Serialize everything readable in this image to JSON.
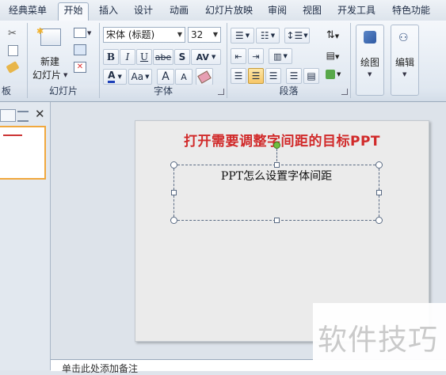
{
  "tabs": [
    "经典菜单",
    "开始",
    "插入",
    "设计",
    "动画",
    "幻灯片放映",
    "审阅",
    "视图",
    "开发工具",
    "特色功能"
  ],
  "active_tab": "开始",
  "ribbon": {
    "slides_group": {
      "label": "幻灯片",
      "new_slide_line1": "新建",
      "new_slide_line2": "幻灯片"
    },
    "font_group": {
      "label": "字体",
      "font_name": "宋体 (标题)",
      "font_size": "32",
      "bold": "B",
      "italic": "I",
      "underline": "U",
      "strikethrough": "abe",
      "shadow": "S",
      "char_spacing": "AV",
      "font_color": "A",
      "change_case": "Aa",
      "grow_font": "A",
      "shrink_font": "A"
    },
    "paragraph_group": {
      "label": "段落"
    },
    "drawing": {
      "label": "绘图"
    },
    "editing": {
      "label": "编辑"
    },
    "clipboard_partial_label": "板"
  },
  "slide": {
    "title": "打开需要调整字间距的目标PPT",
    "textbox_text": "PPT怎么设置字体间距"
  },
  "notes_placeholder": "单击此处添加备注",
  "watermark": "软件技巧",
  "colors": {
    "title_red": "#d12a2a",
    "thumb_border": "#f1a83d",
    "ribbon_bg": "#dfe7f0"
  }
}
